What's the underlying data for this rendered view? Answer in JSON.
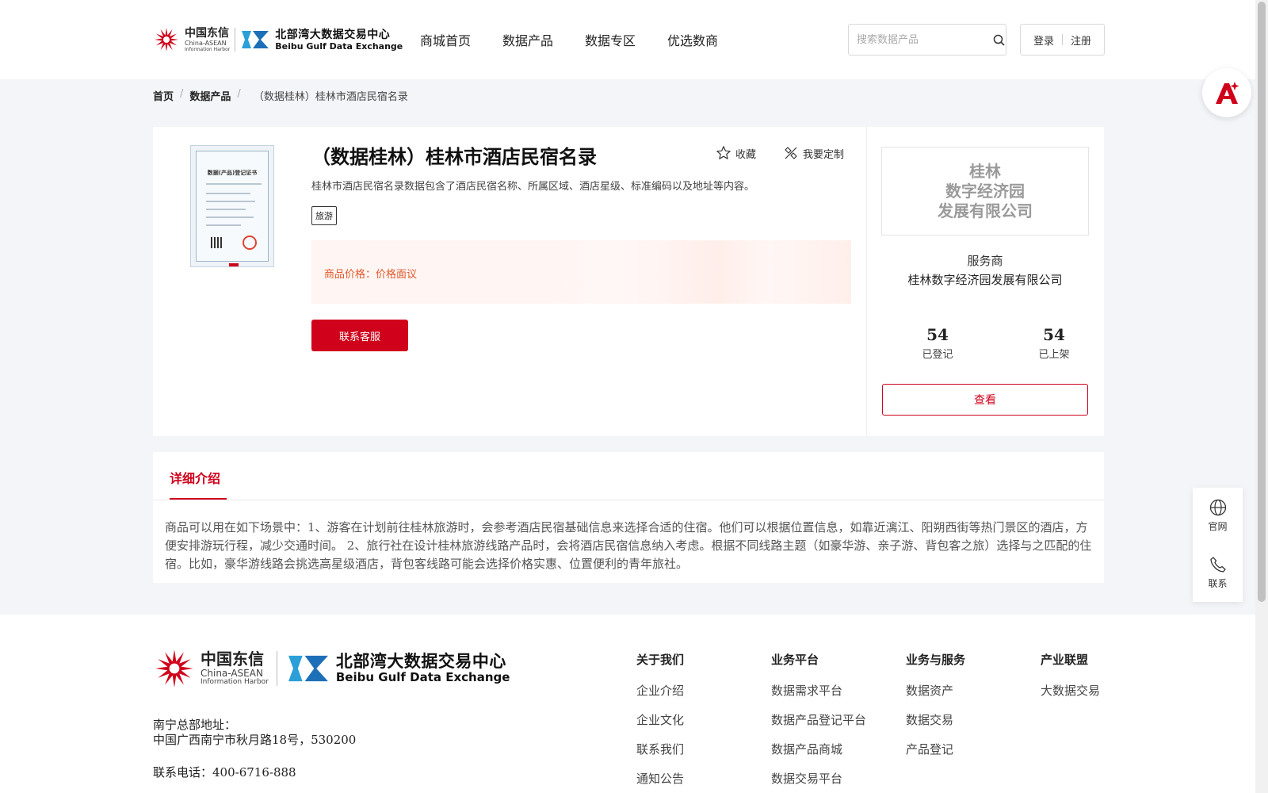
{
  "header": {
    "logo": {
      "ct_cn": "中国东信",
      "ct_en1": "China-ASEAN",
      "ct_en2": "Information Harbor",
      "bg_cn": "北部湾大数据交易中心",
      "bg_en": "Beibu Gulf Data Exchange"
    },
    "nav": [
      "商城首页",
      "数据产品",
      "数据专区",
      "优选数商"
    ],
    "search": {
      "placeholder": "搜索数据产品",
      "icon": "search-icon"
    },
    "login_label": "登录",
    "register_label": "注册"
  },
  "breadcrumb": {
    "home": "首页",
    "category": "数据产品",
    "separator": "/",
    "current": "（数据桂林）桂林市酒店民宿名录"
  },
  "product": {
    "thumbnail_title": "数据(产品)登记证书",
    "title": "（数据桂林）桂林市酒店民宿名录",
    "favorite_label": "收藏",
    "customize_label": "我要定制",
    "description": "桂林市酒店民宿名录数据包含了酒店民宿名称、所属区域、酒店星级、标准编码以及地址等内容。",
    "tag": "旅游",
    "price_label": "商品价格：",
    "price_value": "价格面议",
    "contact_button": "联系客服"
  },
  "provider": {
    "logo_lines": [
      "桂林",
      "数字经济园",
      "发展有限公司"
    ],
    "role": "服务商",
    "name": "桂林数字经济园发展有限公司",
    "registered_count": "54",
    "registered_label": "已登记",
    "listed_count": "54",
    "listed_label": "已上架",
    "view_button": "查看"
  },
  "detail": {
    "tab_label": "详细介绍",
    "body": "商品可以用在如下场景中：1、游客在计划前往桂林旅游时，会参考酒店民宿基础信息来选择合适的住宿。他们可以根据位置信息，如靠近漓江、阳朔西街等热门景区的酒店，方便安排游玩行程，减少交通时间。 2、旅行社在设计桂林旅游线路产品时，会将酒店民宿信息纳入考虑。根据不同线路主题（如豪华游、亲子游、背包客之旅）选择与之匹配的住宿。比如，豪华游线路会挑选高星级酒店，背包客线路可能会选择价格实惠、位置便利的青年旅社。"
  },
  "side_tools": {
    "official_label": "官网",
    "contact_label": "联系"
  },
  "footer": {
    "address_label": "南宁总部地址：",
    "address": "中国广西南宁市秋月路18号，530200",
    "phone": "联系电话：400-6716-888",
    "columns": [
      {
        "title": "关于我们",
        "items": [
          "企业介绍",
          "企业文化",
          "联系我们",
          "通知公告"
        ]
      },
      {
        "title": "业务平台",
        "items": [
          "数据需求平台",
          "数据产品登记平台",
          "数据产品商城",
          "数据交易平台"
        ]
      },
      {
        "title": "业务与服务",
        "items": [
          "数据资产",
          "数据交易",
          "产品登记"
        ]
      },
      {
        "title": "产业联盟",
        "items": [
          "大数据交易"
        ]
      }
    ]
  },
  "colors": {
    "brand_red": "#d0021b",
    "price_orange": "#e05a2b",
    "page_bg": "#f4f5f8"
  }
}
